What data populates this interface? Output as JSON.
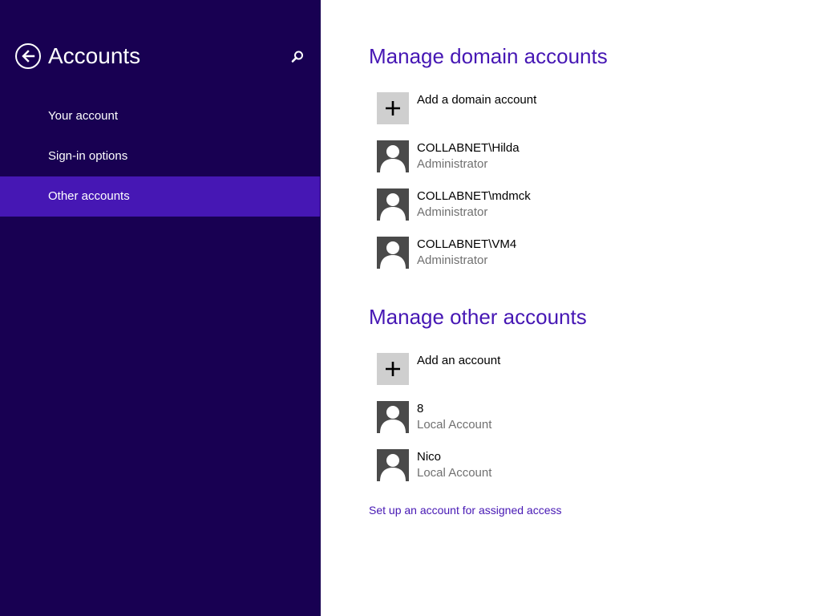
{
  "sidebar": {
    "title": "Accounts",
    "back_icon": "back-arrow-icon",
    "search_icon": "search-icon",
    "items": [
      {
        "label": "Your account",
        "selected": false
      },
      {
        "label": "Sign-in options",
        "selected": false
      },
      {
        "label": "Other accounts",
        "selected": true
      }
    ]
  },
  "domain_section": {
    "title": "Manage domain accounts",
    "add_label": "Add a domain account",
    "accounts": [
      {
        "name": "COLLABNET\\Hilda",
        "role": "Administrator"
      },
      {
        "name": "COLLABNET\\mdmck",
        "role": "Administrator"
      },
      {
        "name": "COLLABNET\\VM4",
        "role": "Administrator"
      }
    ]
  },
  "other_section": {
    "title": "Manage other accounts",
    "add_label": "Add an account",
    "accounts": [
      {
        "name": "8",
        "role": "Local Account"
      },
      {
        "name": "Nico",
        "role": "Local Account"
      }
    ]
  },
  "assigned_access_link": "Set up an account for assigned access",
  "colors": {
    "sidebar_bg": "#180052",
    "selected_bg": "#4617b4",
    "accent": "#4617b4",
    "avatar_bg": "#4a4a4a",
    "add_tile_bg": "#cfcfcf"
  }
}
